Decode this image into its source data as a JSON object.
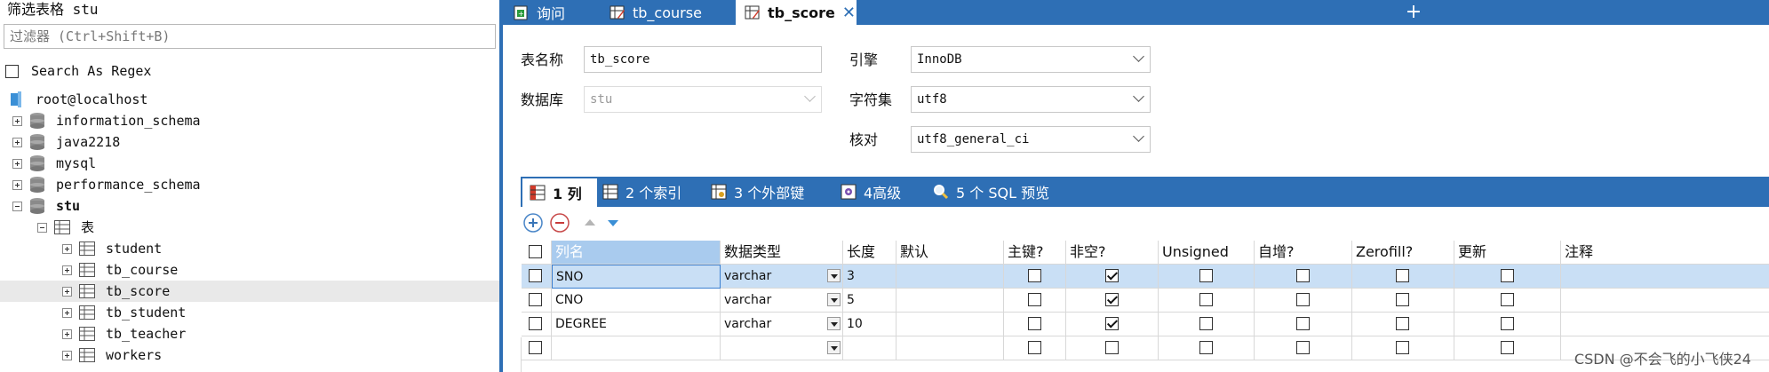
{
  "left_panel": {
    "title": "筛选表格 stu",
    "filter_placeholder": "过滤器 (Ctrl+Shift+B)",
    "search_regex_label": "Search As Regex",
    "connection": "root@localhost",
    "databases": [
      "information_schema",
      "java2218",
      "mysql",
      "performance_schema",
      "stu"
    ],
    "tables_folder": "表",
    "tables": [
      "student",
      "tb_course",
      "tb_score",
      "tb_student",
      "tb_teacher",
      "workers"
    ]
  },
  "tabs": [
    {
      "label": "询问"
    },
    {
      "label": "tb_course"
    },
    {
      "label": "tb_score"
    }
  ],
  "tab_add": "+",
  "tab_close": "✕",
  "form": {
    "table_name_label": "表名称",
    "table_name_value": "tb_score",
    "database_label": "数据库",
    "database_value": "stu",
    "engine_label": "引擎",
    "engine_value": "InnoDB",
    "charset_label": "字符集",
    "charset_value": "utf8",
    "collation_label": "核对",
    "collation_value": "utf8_general_ci"
  },
  "inner_tabs": [
    {
      "label": "1 列"
    },
    {
      "label": "2 个索引"
    },
    {
      "label": "3 个外部键"
    },
    {
      "label": "4高级"
    },
    {
      "label": "5 个 SQL 预览"
    }
  ],
  "grid": {
    "headers": [
      "列名",
      "数据类型",
      "长度",
      "默认",
      "主键?",
      "非空?",
      "Unsigned",
      "自增?",
      "Zerofill?",
      "更新",
      "注释"
    ],
    "rows": [
      {
        "name": "SNO",
        "type": "varchar",
        "length": "3",
        "not_null": true
      },
      {
        "name": "CNO",
        "type": "varchar",
        "length": "5",
        "not_null": true
      },
      {
        "name": "DEGREE",
        "type": "varchar",
        "length": "10",
        "not_null": true
      },
      {
        "name": "",
        "type": "",
        "length": "",
        "not_null": false
      }
    ]
  },
  "watermark": "CSDN @不会飞的小飞侠24",
  "colors": {
    "accent": "#2e6fb5",
    "selection": "#c9dff5"
  }
}
